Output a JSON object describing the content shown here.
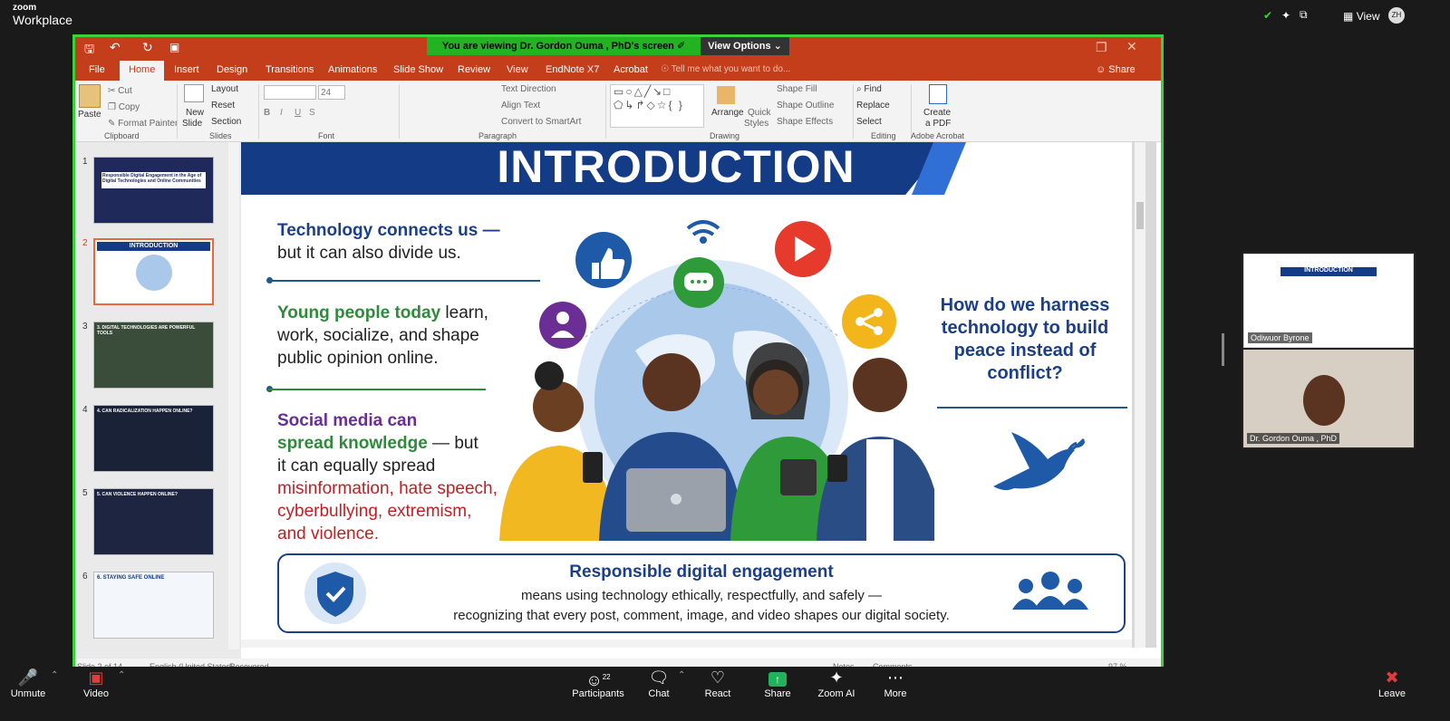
{
  "zoom": {
    "logo_line1": "zoom",
    "logo_line2": "Workplace",
    "view_label": "View",
    "viewing_banner": "You are viewing  Dr. Gordon Ouma , PhD's screen",
    "view_options": "View Options"
  },
  "ppt": {
    "tabs": [
      "File",
      "Home",
      "Insert",
      "Design",
      "Transitions",
      "Animations",
      "Slide Show",
      "Review",
      "View",
      "EndNote X7",
      "Acrobat"
    ],
    "tell_me": "Tell me what you want to do...",
    "share": "Share",
    "ribbon": {
      "paste": "Paste",
      "cut": "Cut",
      "copy": "Copy",
      "format_painter": "Format Painter",
      "clipboard": "Clipboard",
      "new_slide_1": "New",
      "new_slide_2": "Slide",
      "layout": "Layout",
      "reset": "Reset",
      "section": "Section",
      "slides": "Slides",
      "font_size": "24",
      "font": "Font",
      "text_direction": "Text Direction",
      "align_text": "Align Text",
      "convert_smartart": "Convert to SmartArt",
      "paragraph": "Paragraph",
      "arrange": "Arrange",
      "quick_styles_1": "Quick",
      "quick_styles_2": "Styles",
      "shape_fill": "Shape Fill",
      "shape_outline": "Shape Outline",
      "shape_effects": "Shape Effects",
      "drawing": "Drawing",
      "find": "Find",
      "replace": "Replace",
      "select": "Select",
      "editing": "Editing",
      "create_pdf_1": "Create",
      "create_pdf_2": "a PDF",
      "adobe_acrobat": "Adobe Acrobat"
    },
    "thumb_numbers": [
      "1",
      "2",
      "3",
      "4",
      "5",
      "6"
    ],
    "thumb_titles": [
      "Responsible Digital Engagement in the Age of Digital Technologies and Online Communities",
      "INTRODUCTION",
      "3. DIGITAL TECHNOLOGIES ARE POWERFUL TOOLS",
      "4. CAN RADICALIZATION HAPPEN ONLINE?",
      "5. CAN VIOLENCE HAPPEN ONLINE?",
      "6. STAYING SAFE ONLINE"
    ],
    "status_left": "Slide 2 of 14",
    "status_lang": "English (United States)",
    "status_recovered": "Recovered",
    "notes": "Notes",
    "comments": "Comments",
    "zoom_pct": "97 %"
  },
  "slide": {
    "title": "INTRODUCTION",
    "p1_bold": "Technology connects us —",
    "p1_rest": "but it can also divide us.",
    "p2_bold": "Young people today",
    "p2_rest1": " learn,",
    "p2_rest2": "work, socialize, and shape",
    "p2_rest3": "public opinion online.",
    "p3_purple": "Social media can",
    "p3_green": "spread knowledge",
    "p3_dash": " — but",
    "p3_line3": "it can equally spread",
    "p3_red1": "misinformation, hate speech,",
    "p3_red2": "cyberbullying, extremism,",
    "p3_red3": "and violence.",
    "right_q": "How do we harness technology to build peace instead of conflict?",
    "box_title": "Responsible digital engagement",
    "box_line1": "means using technology ethically, respectfully, and safely —",
    "box_line2": "recognizing that every post, comment, image, and video shapes our digital society."
  },
  "participants": {
    "tile1_name": "Odiwuor Byrone",
    "tile2_name": "Dr. Gordon Ouma , PhD"
  },
  "toolbar": {
    "unmute": "Unmute",
    "video": "Video",
    "participants": "Participants",
    "participants_count": "22",
    "chat": "Chat",
    "react": "React",
    "share": "Share",
    "zoom_ai": "Zoom AI",
    "more": "More",
    "leave": "Leave"
  }
}
